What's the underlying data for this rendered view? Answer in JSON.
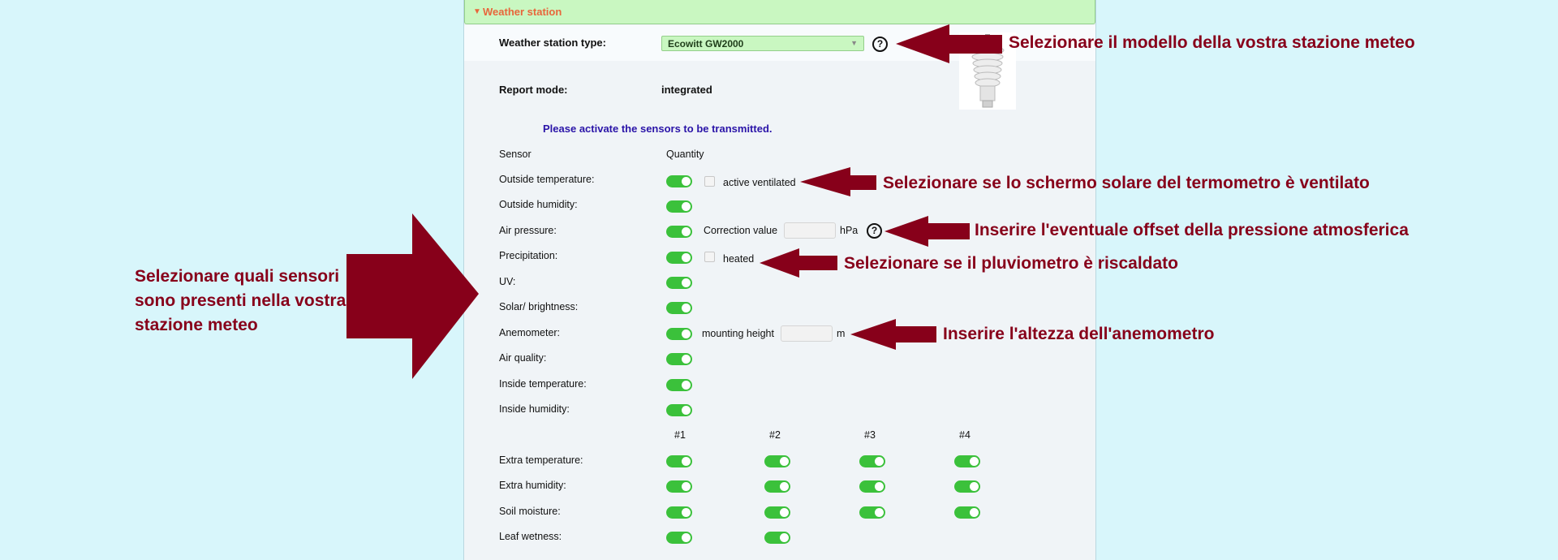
{
  "panel": {
    "title": "Weather station",
    "type_label": "Weather station type:",
    "type_value": "Ecowitt GW2000",
    "report_mode_label": "Report mode:",
    "report_mode_value": "integrated",
    "info_text": "Please activate the sensors to be transmitted.",
    "col_sensor": "Sensor",
    "col_quantity": "Quantity",
    "sensors": [
      {
        "label": "Outside temperature:",
        "extra_label": "active ventilated"
      },
      {
        "label": "Outside humidity:"
      },
      {
        "label": "Air pressure:",
        "extra_label": "Correction value",
        "unit": "hPa"
      },
      {
        "label": "Precipitation:",
        "extra_label": "heated"
      },
      {
        "label": "UV:"
      },
      {
        "label": "Solar/ brightness:"
      },
      {
        "label": "Anemometer:",
        "extra_label": "mounting height",
        "unit": "m"
      },
      {
        "label": "Air quality:"
      },
      {
        "label": "Inside temperature:"
      },
      {
        "label": "Inside humidity:"
      }
    ],
    "extra_columns": [
      "#1",
      "#2",
      "#3",
      "#4"
    ],
    "extra_sensors": [
      {
        "label": "Extra temperature:",
        "count": 4
      },
      {
        "label": "Extra humidity:",
        "count": 4
      },
      {
        "label": "Soil moisture:",
        "count": 4
      },
      {
        "label": "Leaf wetness:",
        "count": 2
      }
    ]
  },
  "annotations": {
    "model": "Selezionare il modello della vostra stazione meteo",
    "ventilated": "Selezionare se lo schermo solare del termometro è ventilato",
    "pressure": "Inserire l'eventuale offset della pressione atmosferica",
    "heated": "Selezionare se il pluviometro è riscaldato",
    "anemometer": "Inserire l'altezza dell'anemometro",
    "sensors": "Selezionare quali sensori sono presenti nella vostra stazione meteo"
  },
  "colors": {
    "annotation": "#87001a",
    "toggle_on": "#3bc13b",
    "header_bg": "#c9f7c1",
    "page_bg": "#d8f6fb"
  },
  "icons": [
    "chevron-down-icon",
    "help-icon",
    "red-arrow-icon"
  ]
}
